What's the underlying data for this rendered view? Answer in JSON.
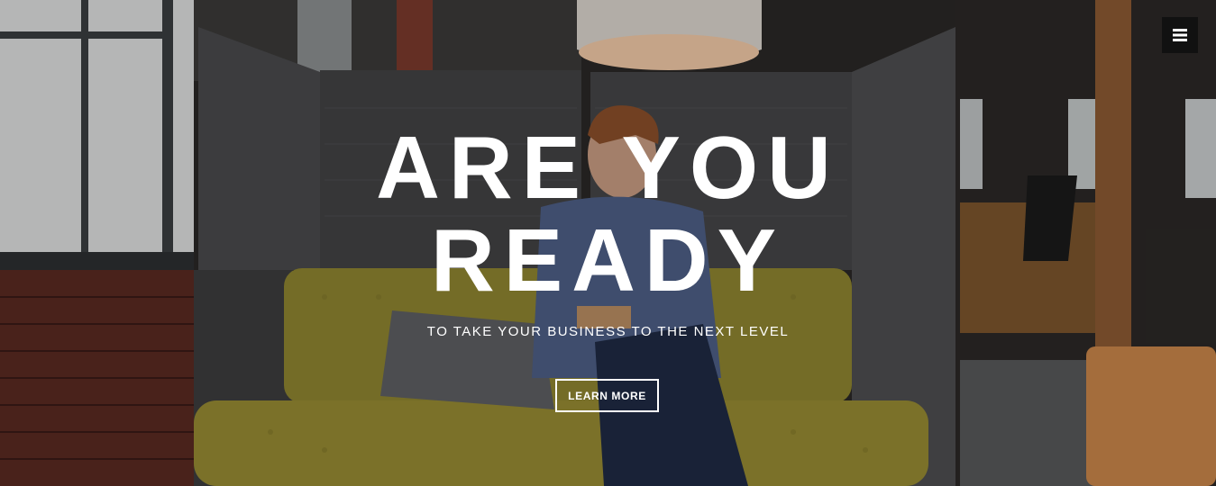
{
  "hero": {
    "title_line1": "ARE YOU",
    "title_line2": "READY",
    "subtitle": "TO TAKE YOUR BUSINESS TO THE NEXT LEVEL",
    "cta_label": "LEARN MORE"
  },
  "nav": {
    "menu_icon": "hamburger-icon"
  },
  "colors": {
    "text": "#ffffff",
    "menu_bg": "#111111",
    "sofa": "#a79a34"
  }
}
